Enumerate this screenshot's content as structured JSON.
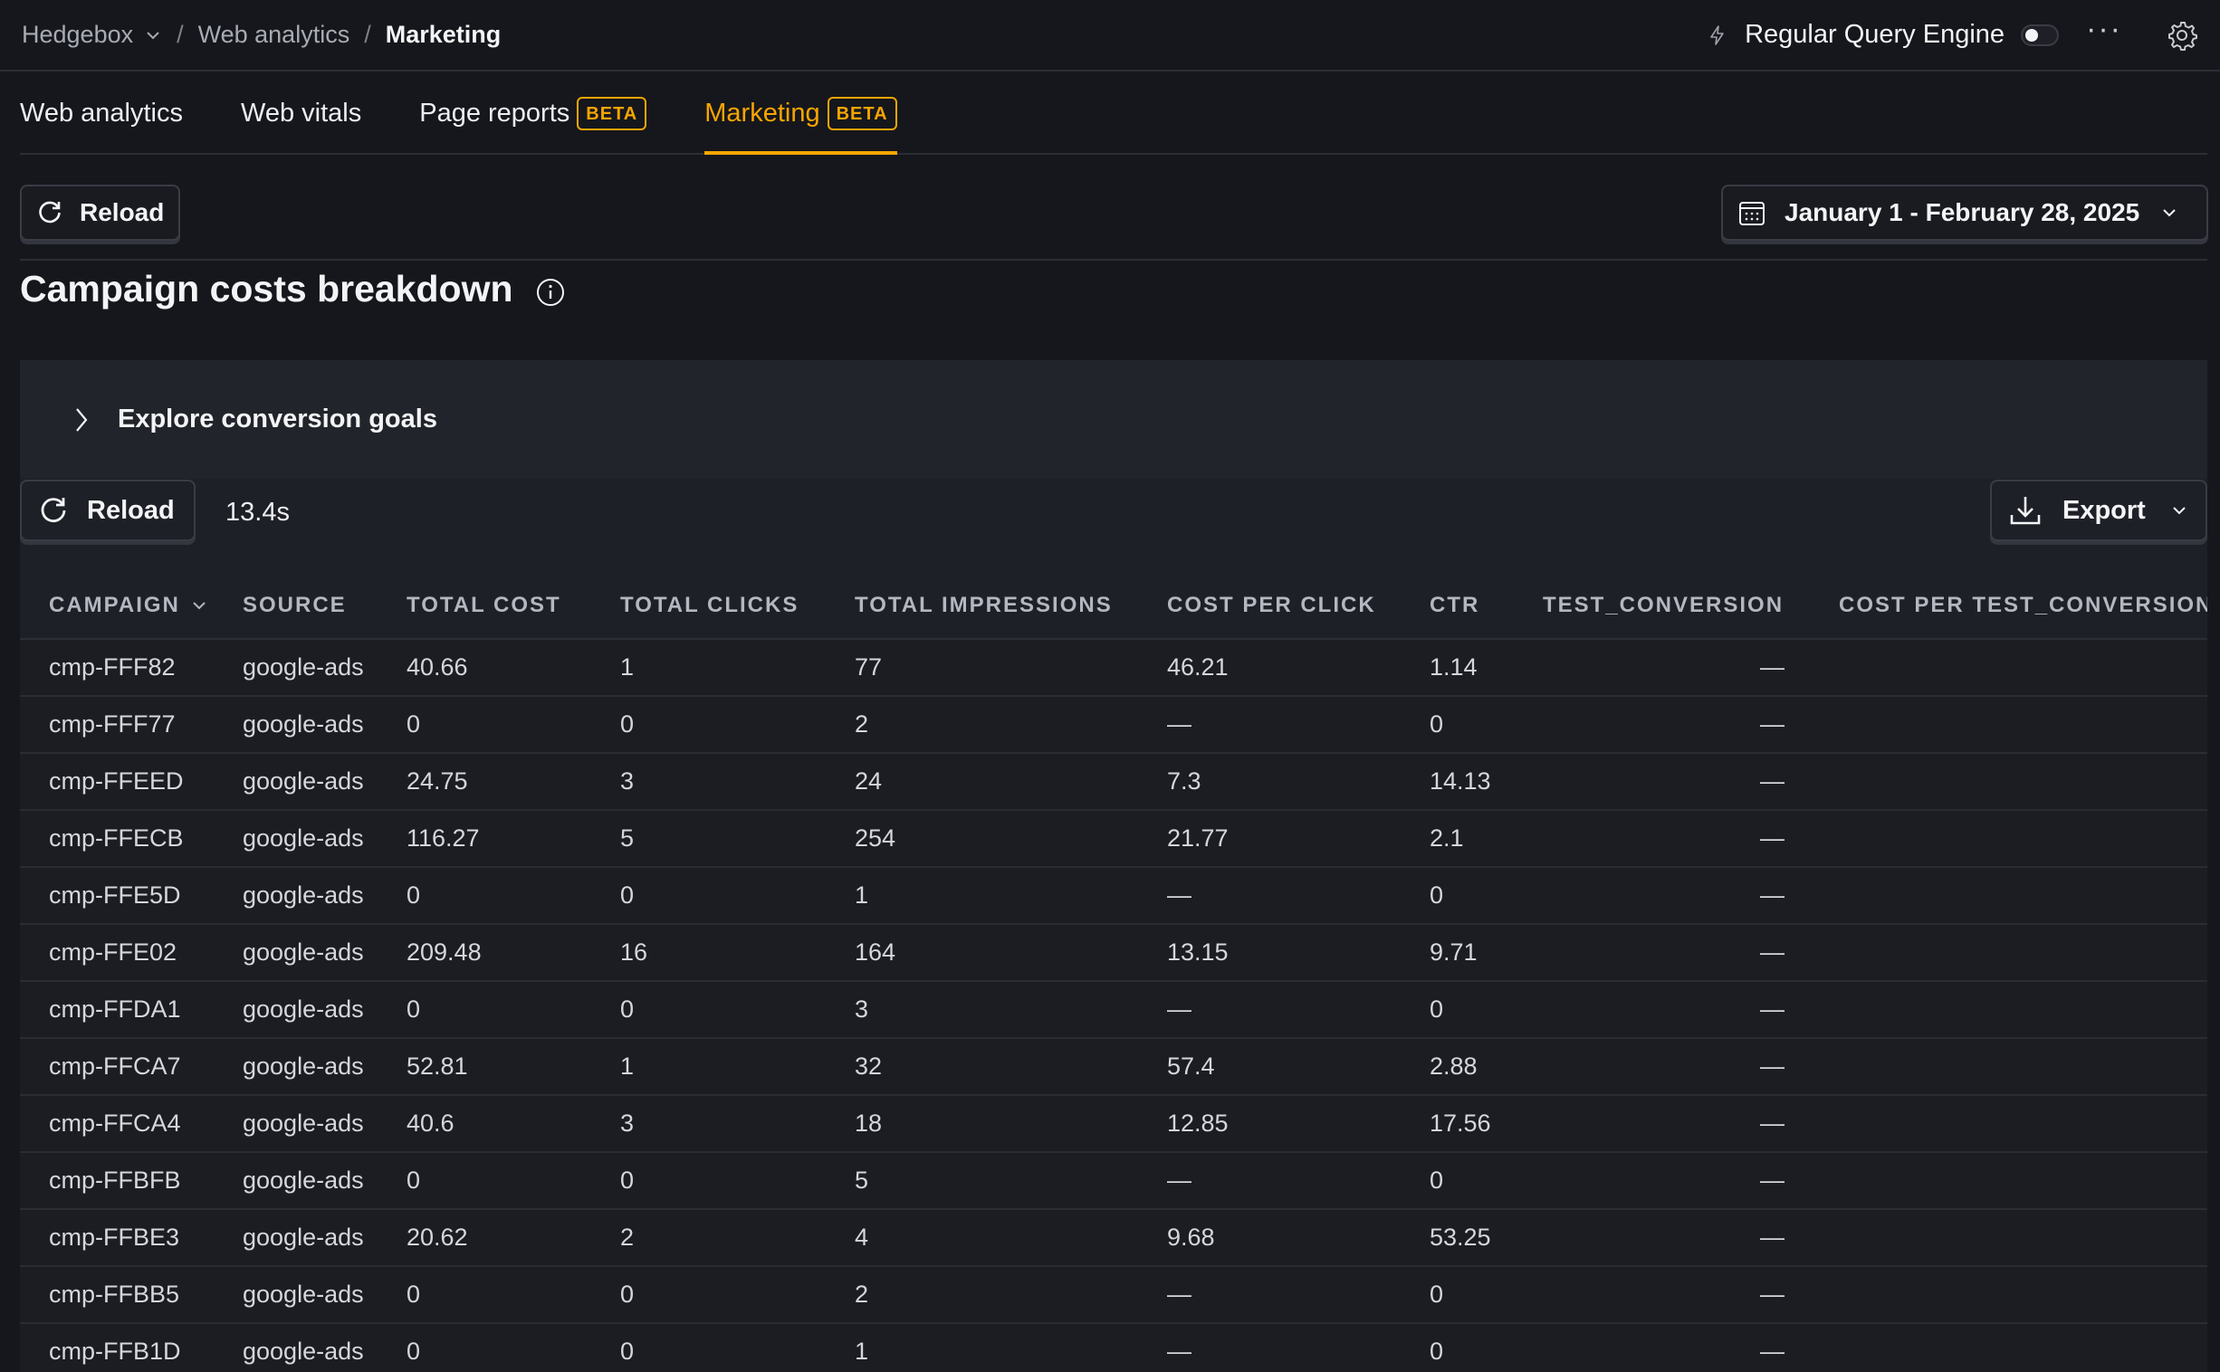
{
  "breadcrumbs": [
    {
      "label": "Hedgebox"
    },
    {
      "label": "Web analytics"
    },
    {
      "label": "Marketing"
    }
  ],
  "topbar": {
    "engine_label": "Regular Query Engine",
    "engine_enabled": false,
    "more_label": "···"
  },
  "tabs": [
    {
      "label": "Web analytics",
      "badge": "",
      "active": false
    },
    {
      "label": "Web vitals",
      "badge": "",
      "active": false
    },
    {
      "label": "Page reports",
      "badge": "BETA",
      "active": false
    },
    {
      "label": "Marketing",
      "badge": "BETA",
      "active": true
    }
  ],
  "toolbar": {
    "reload_label": "Reload",
    "date_range": "January 1 - February 28, 2025"
  },
  "section": {
    "title": "Campaign costs breakdown"
  },
  "panel": {
    "explore_label": "Explore conversion goals",
    "reload_label": "Reload",
    "elapsed": "13.4s",
    "export_label": "Export"
  },
  "table": {
    "columns": [
      "CAMPAIGN",
      "SOURCE",
      "TOTAL COST",
      "TOTAL CLICKS",
      "TOTAL IMPRESSIONS",
      "COST PER CLICK",
      "CTR",
      "TEST_CONVERSION",
      "COST PER TEST_CONVERSION"
    ],
    "rows": [
      [
        "cmp-FFF82",
        "google-ads",
        "40.66",
        "1",
        "77",
        "46.21",
        "1.14",
        "—",
        ""
      ],
      [
        "cmp-FFF77",
        "google-ads",
        "0",
        "0",
        "2",
        "—",
        "0",
        "—",
        ""
      ],
      [
        "cmp-FFEED",
        "google-ads",
        "24.75",
        "3",
        "24",
        "7.3",
        "14.13",
        "—",
        ""
      ],
      [
        "cmp-FFECB",
        "google-ads",
        "116.27",
        "5",
        "254",
        "21.77",
        "2.1",
        "—",
        ""
      ],
      [
        "cmp-FFE5D",
        "google-ads",
        "0",
        "0",
        "1",
        "—",
        "0",
        "—",
        ""
      ],
      [
        "cmp-FFE02",
        "google-ads",
        "209.48",
        "16",
        "164",
        "13.15",
        "9.71",
        "—",
        ""
      ],
      [
        "cmp-FFDA1",
        "google-ads",
        "0",
        "0",
        "3",
        "—",
        "0",
        "—",
        ""
      ],
      [
        "cmp-FFCA7",
        "google-ads",
        "52.81",
        "1",
        "32",
        "57.4",
        "2.88",
        "—",
        ""
      ],
      [
        "cmp-FFCA4",
        "google-ads",
        "40.6",
        "3",
        "18",
        "12.85",
        "17.56",
        "—",
        ""
      ],
      [
        "cmp-FFBFB",
        "google-ads",
        "0",
        "0",
        "5",
        "—",
        "0",
        "—",
        ""
      ],
      [
        "cmp-FFBE3",
        "google-ads",
        "20.62",
        "2",
        "4",
        "9.68",
        "53.25",
        "—",
        ""
      ],
      [
        "cmp-FFBB5",
        "google-ads",
        "0",
        "0",
        "2",
        "—",
        "0",
        "—",
        ""
      ],
      [
        "cmp-FFB1D",
        "google-ads",
        "0",
        "0",
        "1",
        "—",
        "0",
        "—",
        ""
      ]
    ]
  },
  "colors": {
    "accent": "#f7a501",
    "background": "#16171c",
    "panel": "#1e2027"
  }
}
